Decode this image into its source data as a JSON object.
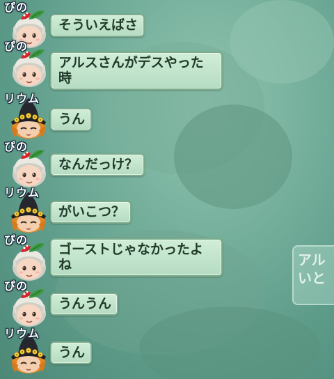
{
  "background": {
    "partial_card_text": [
      "アル",
      "いと"
    ]
  },
  "messages": [
    {
      "speaker": "ぴの",
      "text": "そういえばさ",
      "avatar_icon": "pino-avatar-icon"
    },
    {
      "speaker": "ぴの",
      "text": "アルスさんがデスやった時",
      "avatar_icon": "pino-avatar-icon"
    },
    {
      "speaker": "リウム",
      "text": "うん",
      "avatar_icon": "rium-avatar-icon"
    },
    {
      "speaker": "ぴの",
      "text": "なんだっけ？",
      "avatar_icon": "pino-avatar-icon"
    },
    {
      "speaker": "リウム",
      "text": "がいこつ？",
      "avatar_icon": "rium-avatar-icon"
    },
    {
      "speaker": "ぴの",
      "text": "ゴーストじゃなかったよね",
      "avatar_icon": "pino-avatar-icon"
    },
    {
      "speaker": "ぴの",
      "text": "うんうん",
      "avatar_icon": "pino-avatar-icon"
    },
    {
      "speaker": "リウム",
      "text": "うん",
      "avatar_icon": "rium-avatar-icon"
    }
  ],
  "colors": {
    "bubble_fill": "#c3e5cc",
    "bubble_border": "#7dad8b",
    "bubble_text": "#213a2a",
    "name_text": "#ffffff"
  }
}
